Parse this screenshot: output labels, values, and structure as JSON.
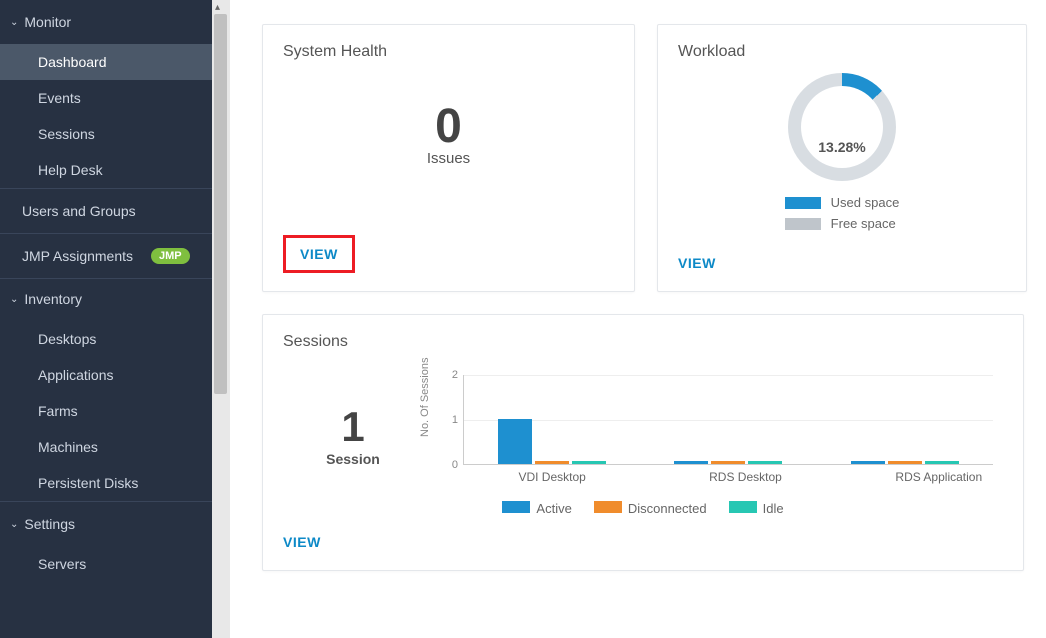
{
  "sidebar": {
    "monitor": {
      "label": "Monitor",
      "items": [
        {
          "label": "Dashboard"
        },
        {
          "label": "Events"
        },
        {
          "label": "Sessions"
        },
        {
          "label": "Help Desk"
        }
      ]
    },
    "users_groups_label": "Users and Groups",
    "jmp_label": "JMP Assignments",
    "jmp_badge": "JMP",
    "inventory": {
      "label": "Inventory",
      "items": [
        {
          "label": "Desktops"
        },
        {
          "label": "Applications"
        },
        {
          "label": "Farms"
        },
        {
          "label": "Machines"
        },
        {
          "label": "Persistent Disks"
        }
      ]
    },
    "settings": {
      "label": "Settings",
      "items": [
        {
          "label": "Servers"
        }
      ]
    }
  },
  "cards": {
    "system_health": {
      "title": "System Health",
      "count": "0",
      "count_label": "Issues",
      "view": "VIEW"
    },
    "workload": {
      "title": "Workload",
      "pct": "13.28%",
      "legend_used": "Used space",
      "legend_free": "Free space",
      "view": "VIEW",
      "colors": {
        "used": "#1e90d0",
        "free": "#bfc5cb"
      }
    },
    "sessions": {
      "title": "Sessions",
      "count": "1",
      "count_label": "Session",
      "view": "VIEW"
    }
  },
  "chart_data": {
    "type": "bar",
    "title": "",
    "ylabel": "No. Of Sessions",
    "ylim": [
      0,
      2
    ],
    "yticks": [
      0,
      1,
      2
    ],
    "categories": [
      "VDI Desktop",
      "RDS Desktop",
      "RDS Application"
    ],
    "series": [
      {
        "name": "Active",
        "color": "#1e90d0",
        "values": [
          1,
          0,
          0
        ]
      },
      {
        "name": "Disconnected",
        "color": "#f08c2c",
        "values": [
          0,
          0,
          0
        ]
      },
      {
        "name": "Idle",
        "color": "#27c7b3",
        "values": [
          0,
          0,
          0
        ]
      }
    ]
  }
}
